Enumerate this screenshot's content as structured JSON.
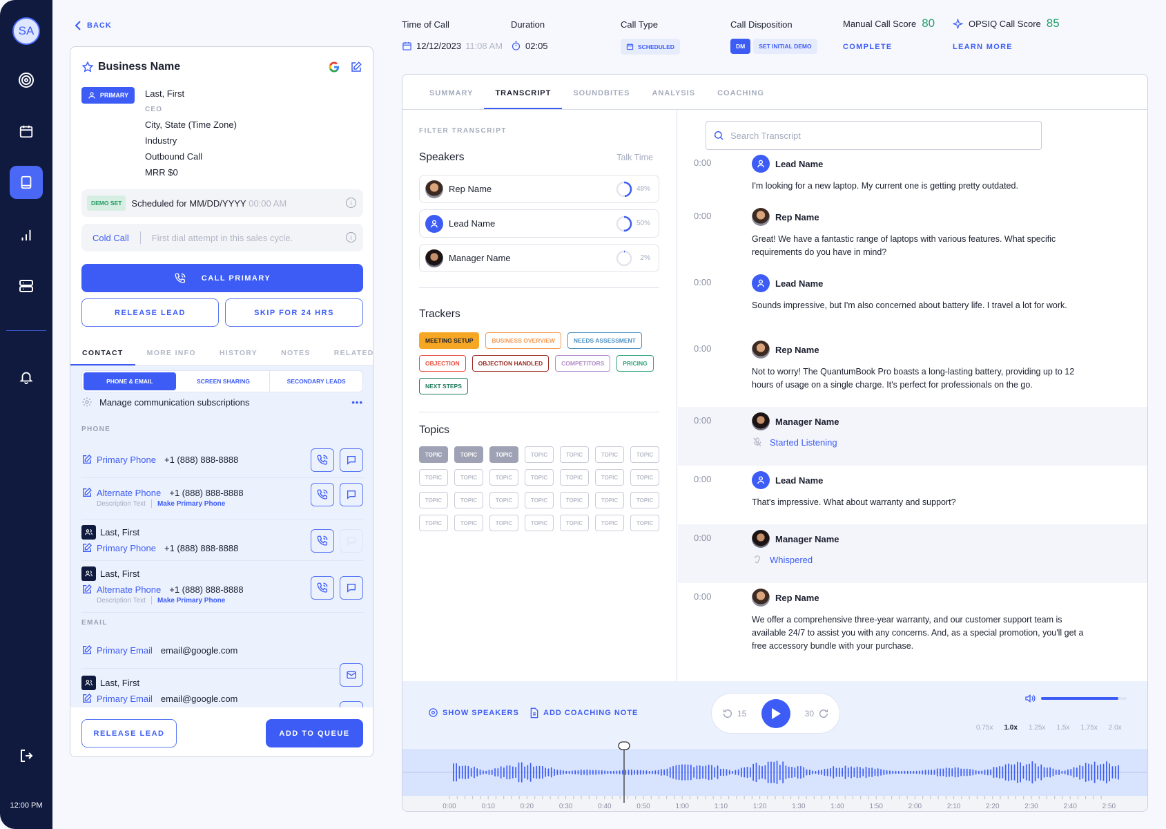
{
  "sidebar": {
    "avatar_initials": "SA",
    "time": "12:00 PM",
    "items": [
      "target-icon",
      "calendar-icon",
      "book-icon",
      "bar-chart-icon",
      "server-icon",
      "bell-icon",
      "logout-icon"
    ],
    "active_item": "book-icon"
  },
  "back": {
    "label": "BACK"
  },
  "lead": {
    "business_name": "Business Name",
    "primary_badge": "PRIMARY",
    "name": "Last, First",
    "title": "CEO",
    "location": "City, State (Time Zone)",
    "industry": "Industry",
    "call_kind": "Outbound Call",
    "mrr": "MRR $0",
    "demo_badge": "DEMO SET",
    "scheduled_label": "Scheduled for",
    "scheduled_date": "MM/DD/YYYY",
    "scheduled_time": "00:00 AM",
    "call_type": "Cold Call",
    "call_type_desc": "First dial attempt in this sales cycle.",
    "call_primary": "CALL PRIMARY",
    "release_lead": "RELEASE LEAD",
    "skip": "SKIP FOR 24 HRS"
  },
  "contact_tabs": [
    {
      "label": "CONTACT",
      "active": true
    },
    {
      "label": "MORE INFO"
    },
    {
      "label": "HISTORY"
    },
    {
      "label": "NOTES"
    },
    {
      "label": "RELATED RE"
    }
  ],
  "segments": [
    {
      "label": "PHONE & EMAIL",
      "active": true
    },
    {
      "label": "SCREEN SHARING"
    },
    {
      "label": "SECONDARY LEADS"
    }
  ],
  "manage_subscriptions": "Manage communication subscriptions",
  "phone_section": "PHONE",
  "email_section": "EMAIL",
  "phones": [
    {
      "label": "Primary Phone",
      "number": "+1 (888) 888-8888"
    },
    {
      "label": "Alternate Phone",
      "number": "+1 (888) 888-8888",
      "desc": "Description Text",
      "make_primary": "Make Primary Phone"
    },
    {
      "person": "Last, First",
      "label": "Primary Phone",
      "number": "+1 (888) 888-8888"
    },
    {
      "person": "Last, First",
      "label": "Alternate Phone",
      "number": "+1 (888) 888-8888",
      "desc": "Description Text",
      "make_primary": "Make Primary Phone"
    }
  ],
  "emails": [
    {
      "label": "Primary Email",
      "value": "email@google.com"
    },
    {
      "person": "Last, First",
      "label": "Primary Email",
      "value": "email@google.com"
    }
  ],
  "footer": {
    "release_lead": "RELEASE LEAD",
    "add_to_queue": "ADD TO QUEUE"
  },
  "call_header": {
    "time_label": "Time of Call",
    "date": "12/12/2023",
    "time": "11:08 AM",
    "duration_label": "Duration",
    "duration": "02:05",
    "type_label": "Call Type",
    "type": "SCHEDULED",
    "disposition_label": "Call Disposition",
    "disposition_code": "DM",
    "disposition": "SET INITIAL DEMO",
    "manual_label": "Manual Call Score",
    "manual_score": "80",
    "manual_status": "COMPLETE",
    "opsiq_label": "OPSIQ Call Score",
    "opsiq_score": "85",
    "learn_more": "LEARN MORE"
  },
  "main_tabs": [
    {
      "label": "SUMMARY"
    },
    {
      "label": "TRANSCRIPT",
      "active": true
    },
    {
      "label": "SOUNDBITES"
    },
    {
      "label": "ANALYSIS"
    },
    {
      "label": "COACHING"
    }
  ],
  "filter": {
    "title": "FILTER TRANSCRIPT",
    "speakers_label": "Speakers",
    "talk_time_label": "Talk Time",
    "speakers": [
      {
        "name": "Rep Name",
        "pct": "48%",
        "value": 0.48
      },
      {
        "name": "Lead Name",
        "pct": "50%",
        "value": 0.5
      },
      {
        "name": "Manager Name",
        "pct": "2%",
        "value": 0.02
      }
    ],
    "trackers_label": "Trackers",
    "trackers": [
      {
        "label": "MEETING SETUP",
        "color": "#f5a623",
        "filled": true
      },
      {
        "label": "BUSINESS OVERVIEW",
        "color": "#f59a52"
      },
      {
        "label": "NEEDS ASSESSMENT",
        "color": "#4a8fc1"
      },
      {
        "label": "OBJECTION",
        "color": "#e84b3c"
      },
      {
        "label": "OBJECTION HANDLED",
        "color": "#9b2c24"
      },
      {
        "label": "COMPETITORS",
        "color": "#b08ac6"
      },
      {
        "label": "PRICING",
        "color": "#2fa37a"
      },
      {
        "label": "NEXT STEPS",
        "color": "#1f7a5a"
      }
    ],
    "topics_label": "Topics",
    "topic_label": "TOPIC",
    "topics_total": 28,
    "topics_selected": 3
  },
  "search": {
    "placeholder": "Search Transcript"
  },
  "transcript": [
    {
      "ts": "0:00",
      "speaker": "Lead Name",
      "role": "lead",
      "text": "I'm looking for a new laptop. My current one is getting pretty outdated."
    },
    {
      "ts": "0:00",
      "speaker": "Rep Name",
      "role": "rep",
      "text": "Great! We have a fantastic range of laptops with various features. What specific requirements do you have in mind?"
    },
    {
      "ts": "0:00",
      "speaker": "Lead Name",
      "role": "lead",
      "text": "Sounds impressive, but I'm also concerned about battery life. I travel a lot for work."
    },
    {
      "ts": "0:00",
      "speaker": "Rep Name",
      "role": "rep",
      "text": "Not to worry! The QuantumBook Pro boasts a long-lasting battery, providing up to 12 hours of usage on a single charge. It's perfect for professionals on the go."
    },
    {
      "ts": "0:00",
      "speaker": "Manager Name",
      "role": "manager",
      "event": "Started Listening",
      "event_icon": "mic-off-icon"
    },
    {
      "ts": "0:00",
      "speaker": "Lead Name",
      "role": "lead",
      "text": "That's impressive. What about warranty and support?"
    },
    {
      "ts": "0:00",
      "speaker": "Manager Name",
      "role": "manager",
      "event": "Whispered",
      "event_icon": "ear-icon"
    },
    {
      "ts": "0:00",
      "speaker": "Rep Name",
      "role": "rep",
      "text": "We offer a comprehensive three-year warranty, and our customer support team is available 24/7 to assist you with any concerns. And, as a special promotion, you'll get a free accessory bundle with your purchase."
    }
  ],
  "player": {
    "show_speakers": "SHOW SPEAKERS",
    "add_note": "ADD COACHING NOTE",
    "rewind": "15",
    "forward": "30",
    "volume": 0.9,
    "speeds": [
      "0.75x",
      "1.0x",
      "1.25x",
      "1.5x",
      "1.75x",
      "2.0x"
    ],
    "active_speed": "1.0x",
    "position_seconds": 45,
    "timeline_labels": [
      "0:00",
      "0:10",
      "0:20",
      "0:30",
      "0:40",
      "0:50",
      "1:00",
      "1:10",
      "1:20",
      "1:30",
      "1:40",
      "1:50",
      "2:00",
      "2:10",
      "2:20",
      "2:30",
      "2:40",
      "2:50"
    ]
  }
}
